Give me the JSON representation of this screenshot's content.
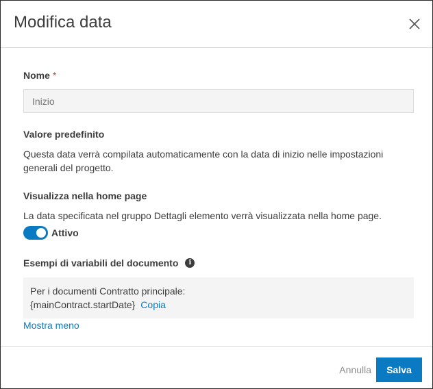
{
  "dialog": {
    "title": "Modifica data"
  },
  "name_field": {
    "label": "Nome",
    "required_mark": "*",
    "placeholder": "Inizio"
  },
  "default_value": {
    "label": "Valore predefinito",
    "description": "Questa data verrà compilata automaticamente con la data di inizio nelle impostazioni generali del progetto."
  },
  "home_page": {
    "label": "Visualizza nella home page",
    "description": "La data specificata nel gruppo Dettagli elemento verrà visualizzata nella home page.",
    "toggle_label": "Attivo"
  },
  "examples": {
    "label": "Esempi di variabili del documento",
    "info_icon": "i",
    "line1": "Per i documenti Contratto principale:",
    "variable": "{mainContract.startDate}",
    "copy_label": "Copia",
    "show_less": "Mostra meno"
  },
  "footer": {
    "cancel_label": "Annulla",
    "save_label": "Salva"
  },
  "colors": {
    "accent": "#0a7ac2",
    "required": "#e03c3c"
  }
}
